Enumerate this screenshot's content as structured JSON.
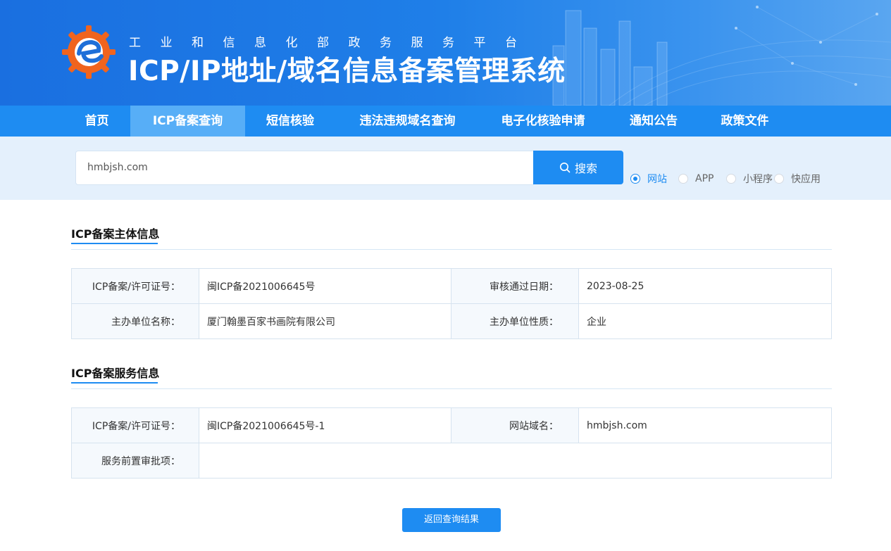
{
  "header": {
    "subtitle": "工业和信息化部政务服务平台",
    "title": "ICP/IP地址/域名信息备案管理系统",
    "logo_icon": "gear-e-logo-icon"
  },
  "nav": {
    "items": [
      {
        "label": "首页",
        "active": false
      },
      {
        "label": "ICP备案查询",
        "active": true
      },
      {
        "label": "短信核验",
        "active": false
      },
      {
        "label": "违法违规域名查询",
        "active": false
      },
      {
        "label": "电子化核验申请",
        "active": false
      },
      {
        "label": "通知公告",
        "active": false
      },
      {
        "label": "政策文件",
        "active": false
      }
    ]
  },
  "search": {
    "value": "hmbjsh.com",
    "button_label": "搜索",
    "button_icon": "search-icon",
    "types": [
      {
        "label": "网站",
        "checked": true
      },
      {
        "label": "APP",
        "checked": false
      },
      {
        "label": "小程序",
        "checked": false
      },
      {
        "label": "快应用",
        "checked": false
      }
    ]
  },
  "subject_section": {
    "title": "ICP备案主体信息",
    "license_label": "ICP备案/许可证号：",
    "license_value": "闽ICP备2021006645号",
    "approve_date_label": "审核通过日期：",
    "approve_date_value": "2023-08-25",
    "org_name_label": "主办单位名称：",
    "org_name_value": "厦门翰墨百家书画院有限公司",
    "org_nature_label": "主办单位性质：",
    "org_nature_value": "企业"
  },
  "service_section": {
    "title": "ICP备案服务信息",
    "license_label": "ICP备案/许可证号：",
    "license_value": "闽ICP备2021006645号-1",
    "domain_label": "网站域名：",
    "domain_value": "hmbjsh.com",
    "preapproval_label": "服务前置审批项：",
    "preapproval_value": ""
  },
  "back_button_label": "返回查询结果",
  "colors": {
    "primary": "#1e8cf2",
    "nav_active": "#57aef7",
    "search_band": "#e4f0fc"
  }
}
